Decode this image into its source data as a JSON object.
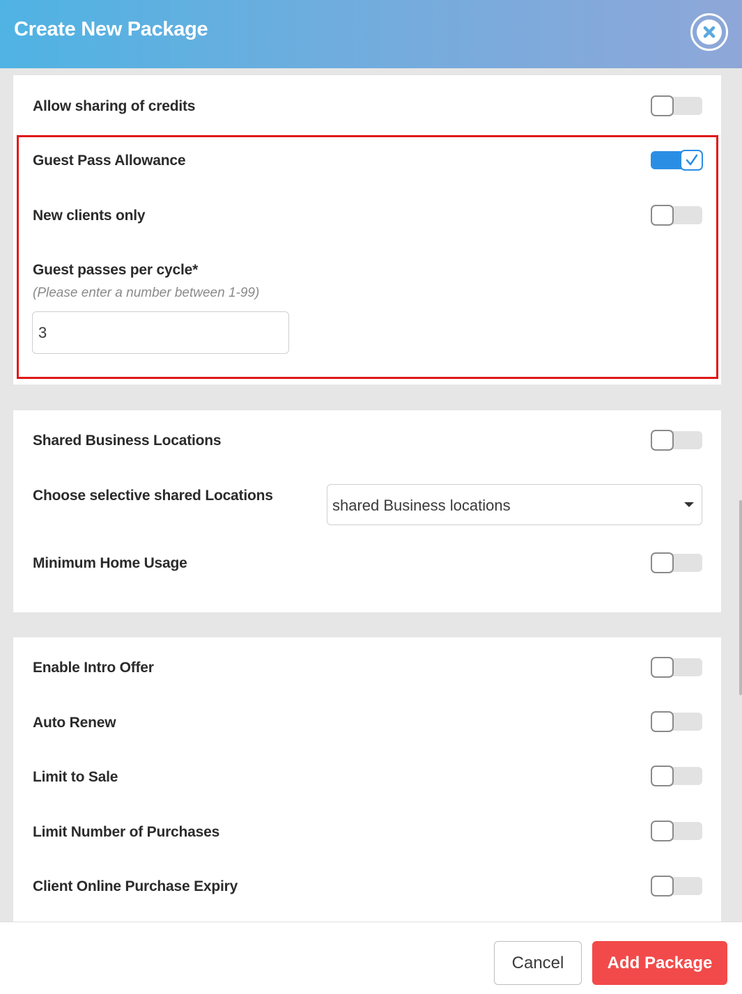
{
  "modal": {
    "title": "Create New Package",
    "close_icon": "close-icon"
  },
  "section_credits": {
    "allow_sharing_label": "Allow sharing of credits",
    "allow_sharing_on": false
  },
  "guest_pass": {
    "allowance_label": "Guest Pass Allowance",
    "allowance_on": true,
    "new_clients_label": "New clients only",
    "new_clients_on": false,
    "per_cycle_label": "Guest passes per cycle*",
    "per_cycle_hint": "(Please enter a number between 1-99)",
    "per_cycle_value": "3"
  },
  "locations": {
    "shared_label": "Shared Business Locations",
    "shared_on": false,
    "selective_label": "Choose selective shared Locations",
    "selective_value": "shared Business locations",
    "min_home_label": "Minimum Home Usage",
    "min_home_on": false
  },
  "offers": {
    "intro_label": "Enable Intro Offer",
    "auto_renew_label": "Auto Renew",
    "limit_sale_label": "Limit to Sale",
    "limit_purchases_label": "Limit Number of Purchases",
    "online_expiry_label": "Client Online Purchase Expiry"
  },
  "footer": {
    "cancel_label": "Cancel",
    "add_label": "Add Package"
  },
  "colors": {
    "accent_blue": "#2b8ee5",
    "danger_red": "#f24a4a",
    "highlight_red": "#e01818"
  }
}
